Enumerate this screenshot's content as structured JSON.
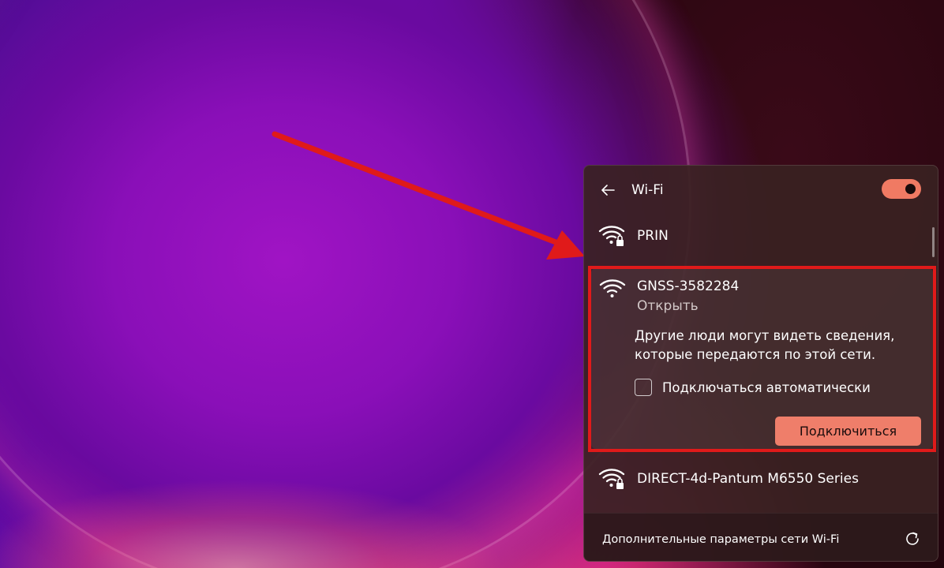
{
  "panel": {
    "title": "Wi-Fi",
    "toggle_on": true,
    "accent_color": "#f07a63"
  },
  "networks": [
    {
      "ssid": "PRIN",
      "secured": true,
      "icon": "wifi-lock-icon"
    },
    {
      "ssid": "GNSS-3582284",
      "secured": false,
      "icon": "wifi-icon",
      "status": "Открыть",
      "expanded": true
    },
    {
      "ssid": "DIRECT-4d-Pantum M6550 Series",
      "secured": true,
      "icon": "wifi-lock-icon"
    }
  ],
  "expanded": {
    "warning": "Другие люди могут видеть сведения, которые передаются по этой сети.",
    "auto_connect_label": "Подключаться автоматически",
    "auto_connect_checked": false,
    "connect_label": "Подключиться"
  },
  "footer": {
    "more_settings_label": "Дополнительные параметры сети Wi-Fi",
    "refresh_icon": "refresh-icon"
  },
  "annotation": {
    "color": "#e01a1a"
  }
}
